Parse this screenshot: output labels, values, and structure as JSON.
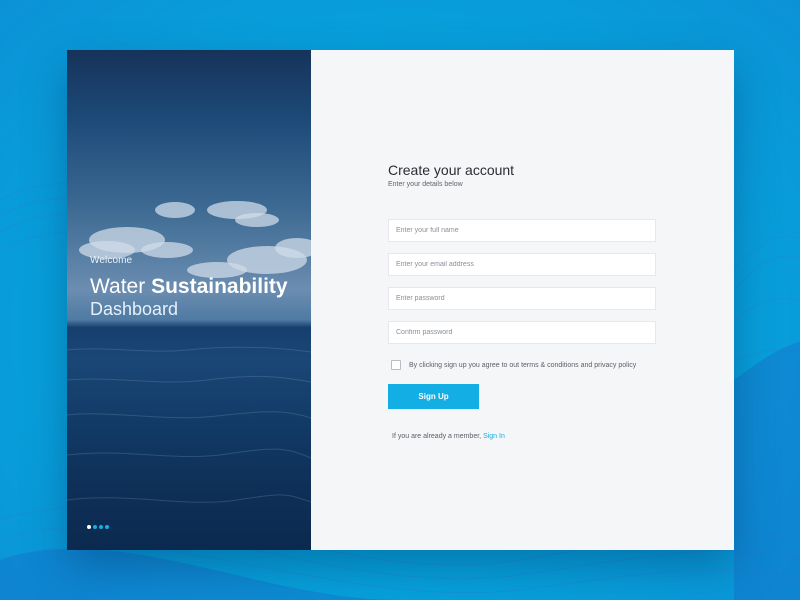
{
  "colors": {
    "page_background": "#06a6de",
    "accent": "#13aee3",
    "form_background": "#f5f6f8",
    "hero_dark": "#0c2a4f"
  },
  "hero": {
    "welcome": "Welcome",
    "title_regular": "Water",
    "title_bold": "Sustainability",
    "subtitle": "Dashboard",
    "carousel": {
      "slides": 4,
      "active_index": 0
    }
  },
  "form": {
    "title": "Create your account",
    "subtitle": "Enter your details below",
    "fields": {
      "full_name": {
        "placeholder": "Enter your full name",
        "value": ""
      },
      "email": {
        "placeholder": "Enter your email address",
        "value": ""
      },
      "password": {
        "placeholder": "Enter password",
        "value": ""
      },
      "confirm_password": {
        "placeholder": "Confirm password",
        "value": ""
      }
    },
    "agree": {
      "checked": false,
      "label": "By clicking sign up you agree to out terms & conditions and privacy policy"
    },
    "submit_label": "Sign Up",
    "member_text": "If you are already a member,",
    "sign_in_link": "Sign In"
  }
}
